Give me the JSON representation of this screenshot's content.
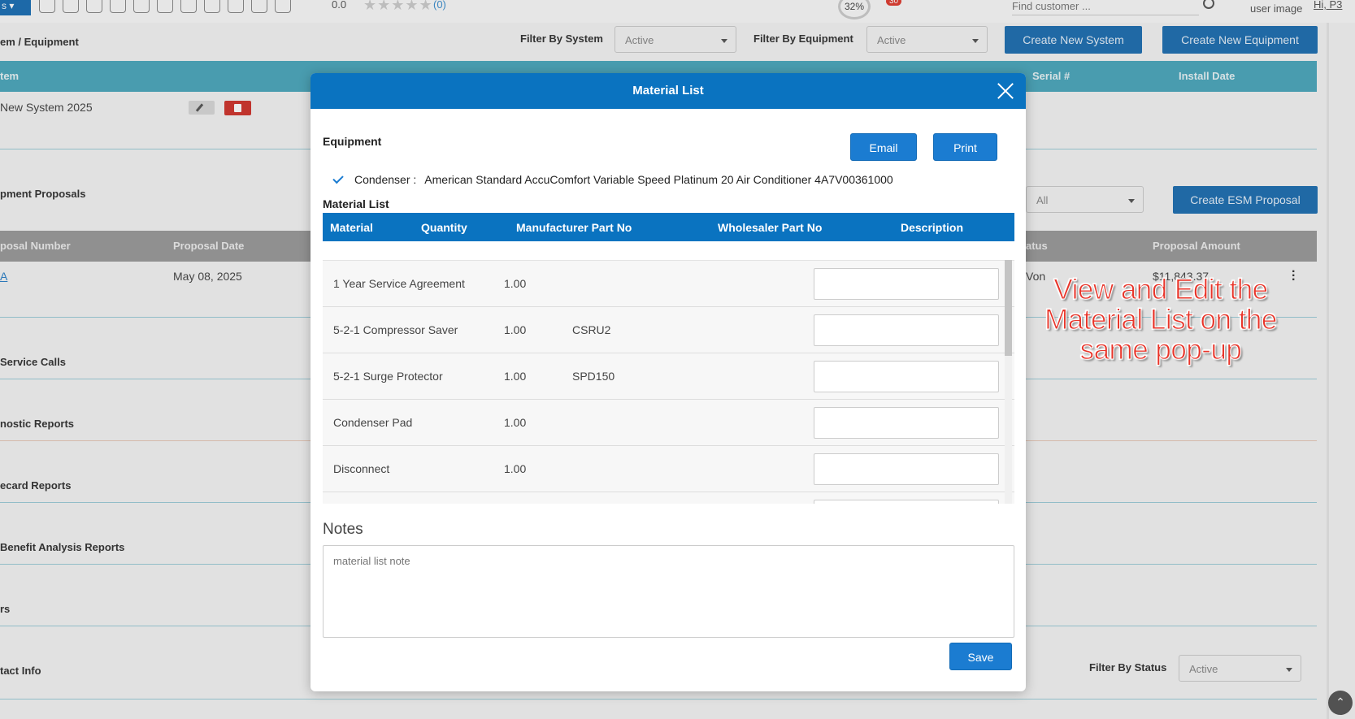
{
  "topbar": {
    "menu_label": "s ▾",
    "rating": "0.0",
    "stars": "★★★★★",
    "rating_count": "(0)",
    "progress": "32%",
    "notification_count": "30",
    "search_placeholder": "Find customer ...",
    "user_image": "user image",
    "greeting": "Hi, P3"
  },
  "page": {
    "section_title": "em / Equipment",
    "filter_system_label": "Filter By System",
    "filter_system_value": "Active",
    "filter_equipment_label": "Filter By Equipment",
    "filter_equipment_value": "Active",
    "create_system_button": "Create New System",
    "create_equipment_button": "Create New Equipment",
    "systems_table": {
      "headers": {
        "system": "tem",
        "serial": "Serial #",
        "install_date": "Install Date"
      },
      "row_name": "New System 2025"
    },
    "proposals_title": "pment Proposals",
    "proposals_filter_value": "All",
    "create_esm_button": "Create ESM Proposal",
    "proposals_table": {
      "headers": {
        "number": "posal Number",
        "date": "Proposal Date",
        "status": "atus",
        "amount": "Proposal Amount"
      },
      "row": {
        "number": "A",
        "date": "May 08, 2025",
        "status": "Von",
        "amount": "$11,843.37"
      }
    },
    "sections": [
      "Service Calls",
      "nostic Reports",
      "ecard Reports",
      "Benefit Analysis Reports",
      "rs",
      "tact Info"
    ],
    "filter_status_label": "Filter By Status",
    "filter_status_value": "Active"
  },
  "modal": {
    "title": "Material List",
    "equipment_label": "Equipment",
    "email_button": "Email",
    "print_button": "Print",
    "equipment_type": "Condenser :",
    "equipment_name": "American Standard AccuComfort Variable Speed Platinum 20 Air Conditioner  4A7V00361000",
    "material_list_label": "Material List",
    "columns": {
      "material": "Material",
      "quantity": "Quantity",
      "manufacturer_part": "Manufacturer Part No",
      "wholesaler_part": "Wholesaler Part No",
      "description": "Description"
    },
    "rows": [
      {
        "material": "1 Year Service Agreement",
        "quantity": "1.00",
        "part": ""
      },
      {
        "material": "5-2-1 Compressor Saver",
        "quantity": "1.00",
        "part": "CSRU2"
      },
      {
        "material": "5-2-1 Surge Protector",
        "quantity": "1.00",
        "part": "SPD150"
      },
      {
        "material": "Condenser Pad",
        "quantity": "1.00",
        "part": ""
      },
      {
        "material": "Disconnect",
        "quantity": "1.00",
        "part": ""
      },
      {
        "material": "",
        "quantity": "",
        "part": ""
      }
    ],
    "notes_label": "Notes",
    "notes_placeholder": "material list note",
    "save_button": "Save"
  },
  "annotation": "View and Edit the Material List on the same pop-up",
  "colors": {
    "primary_blue": "#0a73c0",
    "teal_header": "#4ba7bd",
    "annotation_red": "#e8352a"
  }
}
